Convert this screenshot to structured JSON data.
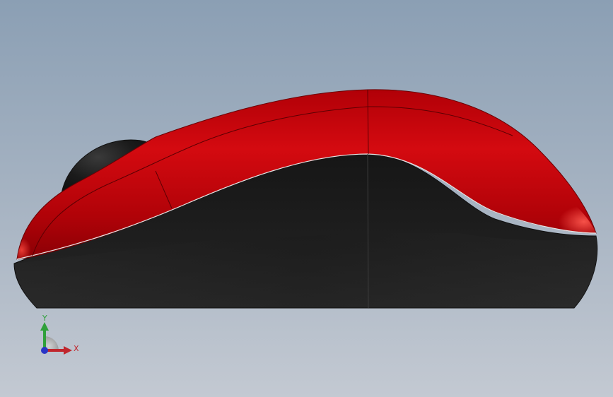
{
  "viewport": {
    "background_top": "#8b9fb4",
    "background_bottom": "#c3c9d2"
  },
  "model": {
    "shell_color": "#c8070d",
    "base_color": "#1d1d1d",
    "wheel_color": "#141414"
  },
  "triad": {
    "x_label": "X",
    "y_label": "Y",
    "x_color": "#c0262d",
    "y_color": "#2fa03a",
    "z_color": "#2a35c6"
  }
}
